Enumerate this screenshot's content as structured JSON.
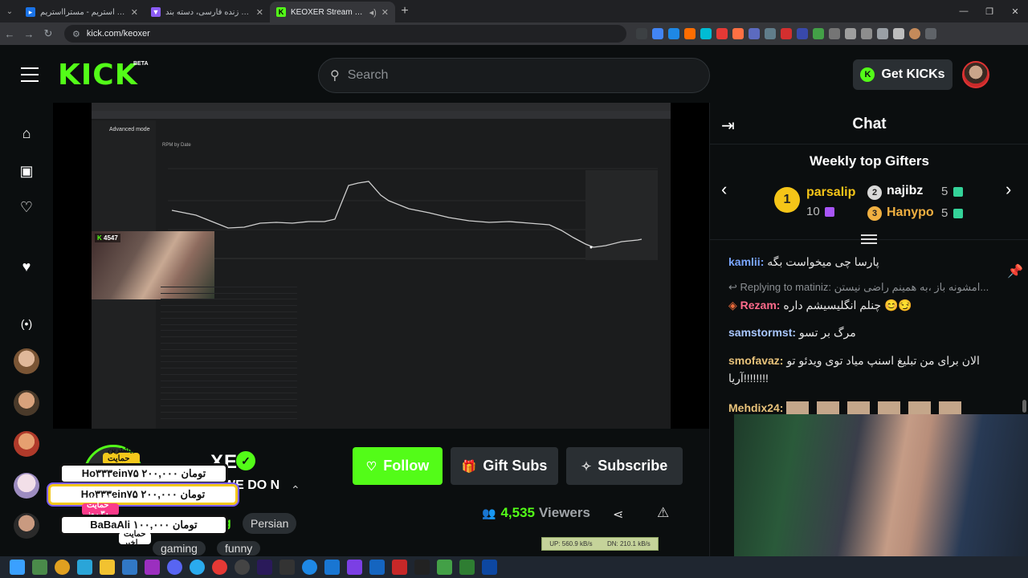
{
  "browser": {
    "tabs": [
      {
        "title": "سرویس ری استریم - مسترااستریم",
        "active": false,
        "color": "#1a73e8"
      },
      {
        "title": "استریم های زنده فارسی، دسته بند",
        "active": false,
        "color": "#8b5cf6"
      },
      {
        "title": "KEOXER Stream - Watch Li",
        "active": true,
        "color": "#53fc18"
      }
    ],
    "url": "kick.com/keoxer"
  },
  "header": {
    "logo": "KICK",
    "beta": "BETA",
    "search_placeholder": "Search",
    "get_kicks": "Get KICKs"
  },
  "video": {
    "yt_title": "Advanced mode",
    "yt_chart_title": "RPM by Date",
    "cam_viewers": "4547"
  },
  "stream": {
    "channel_partial": "XER",
    "title_partial": "WE DO N",
    "category_partial": "g",
    "tags": [
      "Persian",
      "gaming",
      "funny"
    ],
    "follow": "Follow",
    "gift_subs": "Gift Subs",
    "subscribe": "Subscribe",
    "viewers": "4,535",
    "viewers_label": "Viewers",
    "net_up": "UP: 560.9 kB/s",
    "net_dn": "DN: 210.1 kB/s"
  },
  "donations": {
    "top_label": "بیشترین حمایت روز",
    "row1": "Ho۳۳۳ein۷۵   ۲۰۰,۰۰۰ تومان",
    "row2": "Ho۳۳۳ein۷۵   ۲۰۰,۰۰۰ تومان",
    "mid_label": "بیشترین حمایت ۳۰ روز گذشته",
    "row3": "BaBaAli   ۱۰۰,۰۰۰ تومان",
    "bottom_label": "حمایت اخیر"
  },
  "chat": {
    "title": "Chat",
    "gifters_title": "Weekly top Gifters",
    "gifters": [
      {
        "rank": "1",
        "name": "parsalip",
        "count": "10",
        "color": "#f5c518"
      },
      {
        "rank": "2",
        "name": "najibz",
        "count": "5",
        "color": "#ffffff"
      },
      {
        "rank": "3",
        "name": "Hanypo",
        "count": "5",
        "color": "#f0b041"
      }
    ],
    "messages": [
      {
        "user": "kamlii:",
        "text": "پارسا چی میخواست بگه",
        "color": "#7aa6ff"
      },
      {
        "reply": "Replying to matiniz: امشونه باز ،به همینم راضی نیستن..."
      },
      {
        "user": "Rezam:",
        "text": "چنلم انگلیسیشم داره 😊😏",
        "color": "#ff6b8b"
      },
      {
        "user": "samstormst:",
        "text": "مرگ بر تسو",
        "color": "#a9c7ff"
      },
      {
        "user": "smofavaz:",
        "text": "الان برای من تبلیغ اسنپ میاد توی ویدئو تو آریا!!!!!!!!",
        "color": "#e8c27a"
      },
      {
        "user": "Mehdix24:",
        "text": "",
        "color": "#e8c27a"
      }
    ]
  }
}
